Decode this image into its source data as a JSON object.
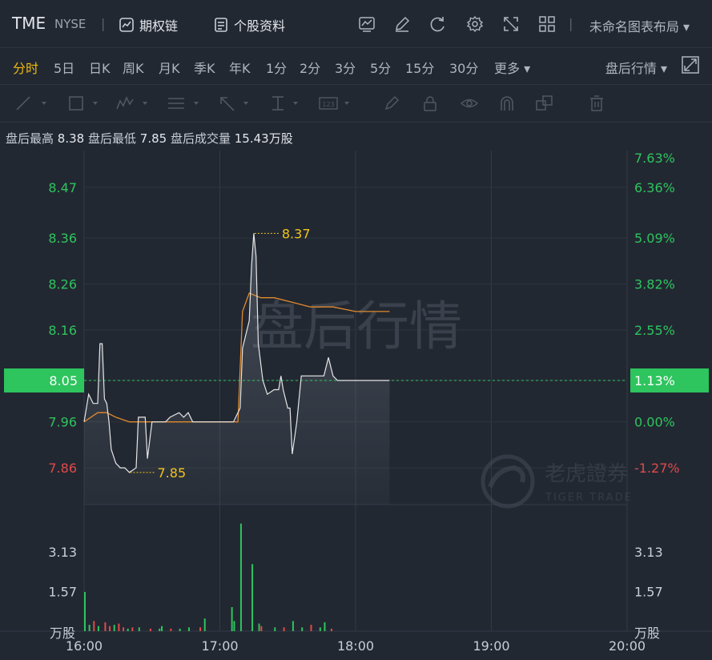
{
  "header": {
    "symbol": "TME",
    "exchange": "NYSE",
    "buttons": [
      {
        "label": "期权链",
        "icon": "chart-box-icon"
      },
      {
        "label": "个股资料",
        "icon": "document-icon"
      }
    ],
    "tools": [
      "indicator-icon",
      "draw-icon",
      "refresh-icon",
      "settings-icon",
      "fullscreen-icon",
      "grid-icon"
    ],
    "layout_label": "未命名图表布局"
  },
  "periods": [
    "分时",
    "5日",
    "日K",
    "周K",
    "月K",
    "季K",
    "年K",
    "1分",
    "2分",
    "3分",
    "5分",
    "15分",
    "30分",
    "更多"
  ],
  "active_period": "分时",
  "after_hours_label": "盘后行情",
  "toolbar_icons": [
    "line-tool-icon",
    "rect-tool-icon",
    "wave-tool-icon",
    "fib-tool-icon",
    "arrow-tool-icon",
    "measure-tool-icon",
    "text-tool-icon",
    "brush-icon",
    "lock-icon",
    "eye-icon",
    "magnet-icon",
    "layers-icon",
    "trash-icon"
  ],
  "summary": {
    "high_label": "盘后最高",
    "high": "8.38",
    "low_label": "盘后最低",
    "low": "7.85",
    "volume_label": "盘后成交量",
    "volume": "15.43万股"
  },
  "watermark": {
    "title": "盘后行情",
    "brand_cn": "老虎證券",
    "brand_en": "TIGER TRADE"
  },
  "colors": {
    "up": "#2ec45e",
    "down": "#e04a4a",
    "price_line": "#e6e6e6",
    "avg_line": "#e08a2c",
    "marker": "#f0c419",
    "current_bg": "#2ec45e"
  },
  "chart_data": {
    "type": "line",
    "x_range": [
      "16:00",
      "20:00"
    ],
    "x_ticks": [
      "16:00",
      "17:00",
      "18:00",
      "19:00",
      "20:00"
    ],
    "y_ticks_left": [
      "8.47",
      "8.36",
      "8.26",
      "8.16",
      "8.05",
      "7.96",
      "7.86"
    ],
    "y_ticks_right": [
      "7.63%",
      "6.36%",
      "5.09%",
      "3.82%",
      "2.55%",
      "1.13%",
      "0.00%",
      "-1.27%"
    ],
    "y_range": [
      7.78,
      8.55
    ],
    "reference_price": 7.96,
    "current_price": "8.05",
    "current_change": "1.13%",
    "max_marker": {
      "time": "17:15",
      "value": "8.37"
    },
    "min_marker": {
      "time": "16:20",
      "value": "7.85"
    },
    "series": [
      {
        "points": [
          [
            "16:00",
            7.96
          ],
          [
            "16:02",
            8.02
          ],
          [
            "16:04",
            8.0
          ],
          [
            "16:06",
            8.0
          ],
          [
            "16:07",
            8.13
          ],
          [
            "16:08",
            8.13
          ],
          [
            "16:09",
            8.01
          ],
          [
            "16:10",
            8.0
          ],
          [
            "16:11",
            7.96
          ],
          [
            "16:12",
            7.9
          ],
          [
            "16:14",
            7.87
          ],
          [
            "16:16",
            7.86
          ],
          [
            "16:18",
            7.86
          ],
          [
            "16:20",
            7.85
          ],
          [
            "16:23",
            7.86
          ],
          [
            "16:24",
            7.97
          ],
          [
            "16:27",
            7.97
          ],
          [
            "16:28",
            7.88
          ],
          [
            "16:30",
            7.96
          ],
          [
            "16:36",
            7.96
          ],
          [
            "16:38",
            7.97
          ],
          [
            "16:42",
            7.98
          ],
          [
            "16:44",
            7.97
          ],
          [
            "16:46",
            7.98
          ],
          [
            "16:48",
            7.96
          ],
          [
            "16:50",
            7.96
          ],
          [
            "16:52",
            7.96
          ],
          [
            "17:00",
            7.96
          ],
          [
            "17:06",
            7.96
          ],
          [
            "17:07",
            7.97
          ],
          [
            "17:09",
            7.99
          ],
          [
            "17:10",
            8.12
          ],
          [
            "17:13",
            8.18
          ],
          [
            "17:14",
            8.3
          ],
          [
            "17:15",
            8.37
          ],
          [
            "17:16",
            8.32
          ],
          [
            "17:17",
            8.13
          ],
          [
            "17:19",
            8.05
          ],
          [
            "17:21",
            8.02
          ],
          [
            "17:24",
            8.03
          ],
          [
            "17:26",
            8.03
          ],
          [
            "17:27",
            8.06
          ],
          [
            "17:28",
            8.03
          ],
          [
            "17:30",
            7.99
          ],
          [
            "17:31",
            7.99
          ],
          [
            "17:32",
            7.89
          ],
          [
            "17:34",
            7.96
          ],
          [
            "17:36",
            8.06
          ],
          [
            "17:40",
            8.06
          ],
          [
            "17:46",
            8.06
          ],
          [
            "17:48",
            8.1
          ],
          [
            "17:50",
            8.06
          ],
          [
            "17:52",
            8.05
          ],
          [
            "17:57",
            8.05
          ],
          [
            "18:15",
            8.05
          ]
        ]
      },
      {
        "points": [
          [
            "16:00",
            7.96
          ],
          [
            "16:06",
            7.98
          ],
          [
            "16:10",
            7.98
          ],
          [
            "16:14",
            7.97
          ],
          [
            "16:20",
            7.96
          ],
          [
            "16:30",
            7.96
          ],
          [
            "16:50",
            7.96
          ],
          [
            "17:06",
            7.96
          ],
          [
            "17:08",
            7.96
          ],
          [
            "17:10",
            8.2
          ],
          [
            "17:13",
            8.24
          ],
          [
            "17:18",
            8.23
          ],
          [
            "17:24",
            8.23
          ],
          [
            "17:32",
            8.22
          ],
          [
            "17:40",
            8.21
          ],
          [
            "17:50",
            8.21
          ],
          [
            "18:00",
            8.2
          ],
          [
            "18:15",
            8.2
          ]
        ]
      }
    ],
    "volume": {
      "unit_label": "万股",
      "y_ticks": [
        "3.13",
        "1.57"
      ],
      "y_max": 5.0,
      "bars": [
        [
          0,
          1.55,
          "up"
        ],
        [
          2,
          0.25,
          "up"
        ],
        [
          4,
          0.4,
          "down"
        ],
        [
          6,
          0.2,
          "up"
        ],
        [
          9,
          0.35,
          "down"
        ],
        [
          11,
          0.2,
          "down"
        ],
        [
          13,
          0.25,
          "up"
        ],
        [
          15,
          0.3,
          "down"
        ],
        [
          17,
          0.15,
          "down"
        ],
        [
          19,
          0.1,
          "up"
        ],
        [
          21,
          0.15,
          "down"
        ],
        [
          24,
          0.15,
          "up"
        ],
        [
          29,
          0.1,
          "down"
        ],
        [
          33,
          0.1,
          "up"
        ],
        [
          34,
          0.2,
          "up"
        ],
        [
          38,
          0.1,
          "down"
        ],
        [
          42,
          0.1,
          "up"
        ],
        [
          46,
          0.15,
          "up"
        ],
        [
          51,
          0.15,
          "down"
        ],
        [
          53,
          0.5,
          "up"
        ],
        [
          65,
          0.95,
          "up"
        ],
        [
          66,
          0.4,
          "up"
        ],
        [
          69,
          4.25,
          "up"
        ],
        [
          74,
          2.65,
          "up"
        ],
        [
          77,
          0.3,
          "up"
        ],
        [
          78,
          0.2,
          "down"
        ],
        [
          84,
          0.15,
          "up"
        ],
        [
          88,
          0.15,
          "down"
        ],
        [
          92,
          0.4,
          "up"
        ],
        [
          96,
          0.15,
          "up"
        ],
        [
          100,
          0.25,
          "down"
        ],
        [
          104,
          0.15,
          "up"
        ],
        [
          106,
          0.35,
          "up"
        ],
        [
          109,
          0.1,
          "down"
        ]
      ]
    }
  }
}
